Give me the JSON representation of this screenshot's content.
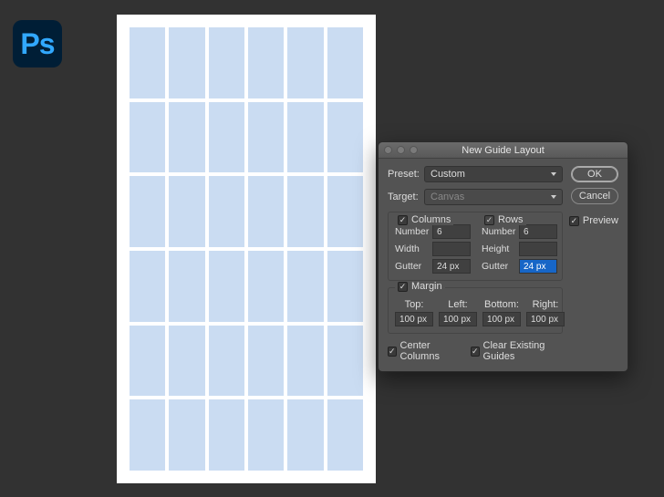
{
  "app": {
    "logo_text": "Ps"
  },
  "dialog": {
    "title": "New Guide Layout",
    "buttons": {
      "ok": "OK",
      "cancel": "Cancel"
    },
    "preview_label": "Preview",
    "preview_checked": true,
    "preset": {
      "label": "Preset:",
      "value": "Custom"
    },
    "target": {
      "label": "Target:",
      "value": "Canvas"
    },
    "columns": {
      "heading": "Columns",
      "checked": true,
      "number_label": "Number",
      "number_value": "6",
      "width_label": "Width",
      "width_value": "",
      "gutter_label": "Gutter",
      "gutter_value": "24 px"
    },
    "rows": {
      "heading": "Rows",
      "checked": true,
      "number_label": "Number",
      "number_value": "6",
      "height_label": "Height",
      "height_value": "",
      "gutter_label": "Gutter",
      "gutter_value": "24 px"
    },
    "margin": {
      "heading": "Margin",
      "checked": true,
      "top_label": "Top:",
      "left_label": "Left:",
      "bottom_label": "Bottom:",
      "right_label": "Right:",
      "top": "100 px",
      "left": "100 px",
      "bottom": "100 px",
      "right": "100 px"
    },
    "center_columns_label": "Center Columns",
    "center_columns_checked": true,
    "clear_guides_label": "Clear Existing Guides",
    "clear_guides_checked": true
  }
}
